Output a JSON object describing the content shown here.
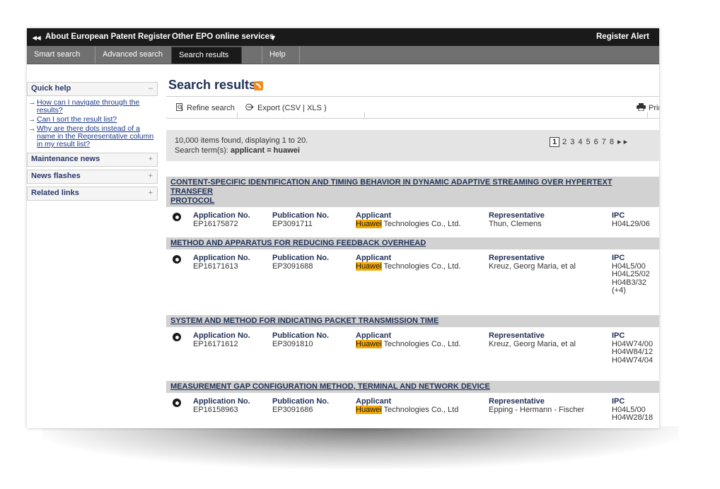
{
  "top_nav": {
    "back_arrow": "◂◂",
    "about_label": "About European Patent Register",
    "other_services_label": "Other EPO online services",
    "other_services_caret": "▾",
    "register_alert_label": "Register Alert"
  },
  "tabs": [
    "Smart search",
    "Advanced search",
    "Search results",
    "Help"
  ],
  "active_tab": "Search results",
  "sidebar": {
    "quick_help": {
      "title": "Quick help",
      "toggle": "–",
      "links": [
        "How can I navigate through the results?",
        "Can I sort the result list?",
        "Why are there dots instead of a name in the Representative column in my result list?"
      ]
    },
    "sections": [
      {
        "title": "Maintenance news",
        "toggle": "+"
      },
      {
        "title": "News flashes",
        "toggle": "+"
      },
      {
        "title": "Related links",
        "toggle": "+"
      }
    ]
  },
  "page": {
    "title": "Search results",
    "toolbar": {
      "refine_label": "Refine search",
      "export_label": "Export  (CSV | XLS )",
      "print_label": "Prin"
    },
    "summary": {
      "found_text": "10,000 items found, displaying 1 to 20.",
      "search_term_prefix": "Search term(s): ",
      "search_term": "applicant = huawei"
    },
    "pager": {
      "current": "1",
      "pages": [
        "2",
        "3",
        "4",
        "5",
        "6",
        "7",
        "8"
      ],
      "next": "▸ ▸"
    }
  },
  "column_labels": {
    "application": "Application No.",
    "publication": "Publication No.",
    "applicant": "Applicant",
    "representative": "Representative",
    "ipc": "IPC"
  },
  "results": [
    {
      "title_line1": "CONTENT-SPECIFIC IDENTIFICATION AND TIMING BEHAVIOR IN DYNAMIC ADAPTIVE STREAMING OVER HYPERTEXT TRANSFER",
      "title_line2": "PROTOCOL",
      "application_no": "EP16175872",
      "publication_no": "EP3091711",
      "applicant_hl": "Huawei",
      "applicant_rest": " Technologies Co., Ltd.",
      "representative": "Thun, Clemens",
      "ipc": [
        "H04L29/06"
      ]
    },
    {
      "title_line1": "METHOD AND APPARATUS FOR REDUCING FEEDBACK OVERHEAD",
      "title_line2": "",
      "application_no": "EP16171613",
      "publication_no": "EP3091688",
      "applicant_hl": "Huawei",
      "applicant_rest": " Technologies Co., Ltd.",
      "representative": "Kreuz, Georg Maria, et al",
      "ipc": [
        "H04L5/00",
        "H04L25/02",
        "H04B3/32",
        "(+4)"
      ]
    },
    {
      "title_line1": "SYSTEM AND METHOD FOR INDICATING PACKET TRANSMISSION TIME",
      "title_line2": "",
      "application_no": "EP16171612",
      "publication_no": "EP3091810",
      "applicant_hl": "Huawei",
      "applicant_rest": " Technologies Co., Ltd.",
      "representative": "Kreuz, Georg Maria, et al",
      "ipc": [
        "H04W74/00",
        "H04W84/12",
        "H04W74/04"
      ]
    },
    {
      "title_line1": "MEASUREMENT GAP CONFIGURATION METHOD, TERMINAL AND NETWORK DEVICE",
      "title_line2": "",
      "application_no": "EP16158963",
      "publication_no": "EP3091686",
      "applicant_hl": "Huawei",
      "applicant_rest": " Technologies Co., Ltd",
      "representative": "Epping - Hermann - Fischer",
      "ipc": [
        "H04L5/00",
        "H04W28/18"
      ]
    }
  ],
  "colors": {
    "top_bar": "#1a1a1a",
    "tab_bar": "#707070",
    "title_blue": "#1f2f55",
    "link_blue": "#1a3a8a",
    "result_header": "#d2d2d2",
    "summary_bg": "#e4e4e4",
    "highlight": "#f5a800",
    "rss": "#f08a1a"
  },
  "icons": {
    "refine": "magnifier-page-icon",
    "export": "export-arrow-icon",
    "print": "printer-icon",
    "rss": "rss-feed-icon",
    "result_marker": "radio-circle-icon"
  }
}
